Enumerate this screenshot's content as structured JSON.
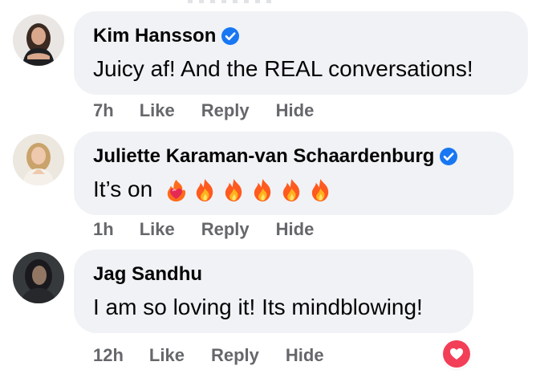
{
  "comments": [
    {
      "author": "Kim Hansson",
      "verified": true,
      "text": "Juicy af! And the REAL conversations!",
      "time": "7h",
      "actions": [
        "Like",
        "Reply",
        "Hide"
      ]
    },
    {
      "author": "Juliette Karaman-van Schaardenburg",
      "verified": true,
      "text": "It’s on",
      "emojis": [
        "heart-on-fire-icon",
        "fire-icon",
        "fire-icon",
        "fire-icon",
        "fire-icon",
        "fire-icon"
      ],
      "time": "1h",
      "actions": [
        "Like",
        "Reply",
        "Hide"
      ]
    },
    {
      "author": "Jag Sandhu",
      "verified": false,
      "text": "I am so loving it! Its mindblowing!",
      "time": "12h",
      "actions": [
        "Like",
        "Reply",
        "Hide"
      ],
      "reaction": "love-reaction-icon"
    }
  ],
  "colors": {
    "bubble": "#f0f2f5",
    "text": "#050505",
    "meta": "#65676b",
    "verified": "#1877f2",
    "love": "#f33e58"
  }
}
